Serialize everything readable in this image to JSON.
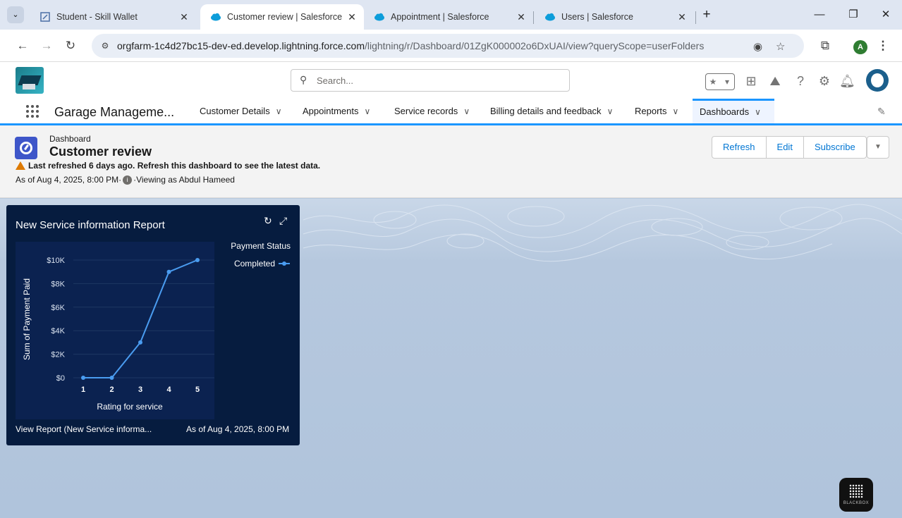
{
  "browser": {
    "tabs": [
      {
        "title": "Student - Skill Wallet",
        "icon": "document-icon"
      },
      {
        "title": "Customer review | Salesforce",
        "icon": "salesforce-cloud-icon",
        "active": true
      },
      {
        "title": "Appointment | Salesforce",
        "icon": "salesforce-cloud-icon"
      },
      {
        "title": "Users | Salesforce",
        "icon": "salesforce-cloud-icon"
      }
    ],
    "url_domain": "orgfarm-1c4d27bc15-dev-ed.develop.lightning.force.com",
    "url_path": "/lightning/r/Dashboard/01ZgK000002o6DxUAI/view?queryScope=userFolders",
    "profile_initial": "A"
  },
  "sf": {
    "search_placeholder": "Search...",
    "app_name": "Garage Manageme...",
    "nav": [
      {
        "label": "Customer Details"
      },
      {
        "label": "Appointments"
      },
      {
        "label": "Service records"
      },
      {
        "label": "Billing details and feedback"
      },
      {
        "label": "Reports"
      },
      {
        "label": "Dashboards",
        "active": true
      }
    ]
  },
  "dashboard": {
    "type_label": "Dashboard",
    "title": "Customer review",
    "warning": "Last refreshed 6 days ago. Refresh this dashboard to see the latest data.",
    "as_of": "As of Aug 4, 2025, 8:00 PM·",
    "viewing_as": "·Viewing as Abdul Hameed",
    "buttons": {
      "refresh": "Refresh",
      "edit": "Edit",
      "subscribe": "Subscribe"
    }
  },
  "widget": {
    "title": "New Service information Report",
    "footer_left": "View Report (New Service informa...",
    "footer_right": "As of Aug 4, 2025, 8:00 PM"
  },
  "chart_data": {
    "type": "line",
    "x": [
      1,
      2,
      3,
      4,
      5
    ],
    "series": [
      {
        "name": "Completed",
        "values": [
          0,
          0,
          3000,
          9000,
          10000
        ]
      }
    ],
    "y_ticks": [
      "$0",
      "$2K",
      "$4K",
      "$6K",
      "$8K",
      "$10K"
    ],
    "x_ticks": [
      "1",
      "2",
      "3",
      "4",
      "5"
    ],
    "xlabel": "Rating for service",
    "ylabel": "Sum of Payment Paid",
    "legend_title": "Payment Status",
    "legend_position": "top-right",
    "ylim": [
      0,
      10000
    ],
    "colors": {
      "line": "#4a9cf0",
      "background": "#061c3f",
      "grid": "#1e3763"
    }
  },
  "overlay": {
    "badge": "BLACKBOX"
  }
}
